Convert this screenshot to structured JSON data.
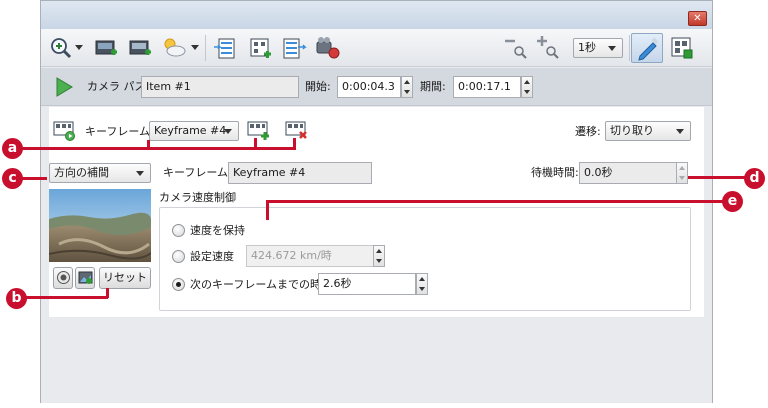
{
  "toolbar": {
    "icons": [
      "zoom-in-icon",
      "add-location-icon",
      "add-view-icon",
      "weather-icon",
      "import-icon",
      "add-keyframe-icon",
      "export-icon",
      "record-icon",
      "zoom-out-icon",
      "zoom-fit-icon",
      "draw-tool-icon",
      "grid-view-icon"
    ],
    "step_value": "1秒"
  },
  "path_bar": {
    "camera_path_label": "カメラ パス:",
    "camera_path_value": "Item #1",
    "start_label": "開始:",
    "start_value": "0:00:04.3",
    "duration_label": "期間:",
    "duration_value": "0:00:17.1"
  },
  "keyframe_row": {
    "label": "キーフレーム:",
    "selected": "Keyframe #4",
    "transition_label": "遷移:",
    "transition_value": "切り取り"
  },
  "details": {
    "direction_mode": "方向の補間",
    "keyframe_label": "キーフレーム:",
    "keyframe_value": "Keyframe #4",
    "wait_label": "待機時間:",
    "wait_value": "0.0秒",
    "reset_label": "リセット"
  },
  "speed_group": {
    "title": "カメラ速度制御",
    "options": [
      {
        "label": "速度を保持",
        "selected": false
      },
      {
        "label": "設定速度",
        "selected": false,
        "value": "424.672 km/時"
      },
      {
        "label": "次のキーフレームまでの時間",
        "selected": true,
        "value": "2.6秒"
      }
    ]
  },
  "callouts": [
    "a",
    "b",
    "c",
    "d",
    "e"
  ],
  "colors": {
    "callout": "#c8102e",
    "accent": "#3c8dd9",
    "play": "#4caf50"
  }
}
